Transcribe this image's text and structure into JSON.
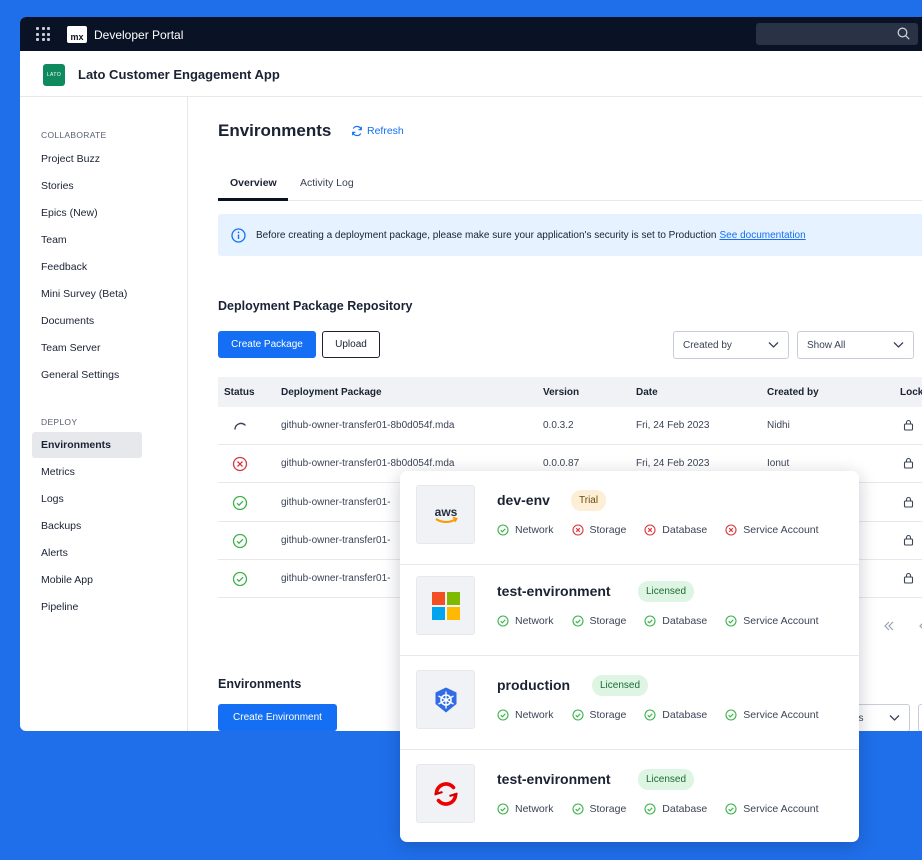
{
  "topbar": {
    "title": "Developer Portal",
    "logo_text": "mx"
  },
  "app": {
    "name": "Lato Customer Engagement App",
    "logo_text": "LATO"
  },
  "sidebar": {
    "collaborate_label": "COLLABORATE",
    "collaborate_items": [
      "Project Buzz",
      "Stories",
      "Epics (New)",
      "Team",
      "Feedback",
      "Mini Survey (Beta)",
      "Documents",
      "Team Server",
      "General Settings"
    ],
    "deploy_label": "DEPLOY",
    "deploy_items": [
      "Environments",
      "Metrics",
      "Logs",
      "Backups",
      "Alerts",
      "Mobile App",
      "Pipeline"
    ],
    "active_item": "Environments"
  },
  "main": {
    "title": "Environments",
    "refresh_label": "Refresh",
    "tabs": [
      "Overview",
      "Activity Log"
    ],
    "banner_text": "Before creating a deployment package, please make sure your application's security is set to Production",
    "banner_link": "See documentation",
    "repo_title": "Deployment Package Repository",
    "create_package_label": "Create Package",
    "upload_label": "Upload",
    "created_by_select": "Created by",
    "show_all_select": "Show All",
    "environments_title": "Environments",
    "create_environment_label": "Create Environment",
    "partial_select_text": "ces"
  },
  "table": {
    "headers": [
      "Status",
      "Deployment Package",
      "Version",
      "Date",
      "Created by",
      "Lock"
    ],
    "rows": [
      {
        "status": "loading",
        "package": "github-owner-transfer01-8b0d054f.mda",
        "version": "0.0.3.2",
        "date": "Fri, 24 Feb 2023",
        "created_by": "Nidhi"
      },
      {
        "status": "error",
        "package": "github-owner-transfer01-8b0d054f.mda",
        "version": "0.0.0.87",
        "date": "Fri, 24 Feb 2023",
        "created_by": "Ionut"
      },
      {
        "status": "success",
        "package": "github-owner-transfer01-",
        "version": "",
        "date": "",
        "created_by": ""
      },
      {
        "status": "success",
        "package": "github-owner-transfer01-",
        "version": "",
        "date": "",
        "created_by": ""
      },
      {
        "status": "success",
        "package": "github-owner-transfer01-",
        "version": "",
        "date": "",
        "created_by": ""
      }
    ]
  },
  "environments": [
    {
      "name": "dev-env",
      "badge": "Trial",
      "provider": "aws",
      "checks": [
        {
          "label": "Network",
          "ok": true
        },
        {
          "label": "Storage",
          "ok": false
        },
        {
          "label": "Database",
          "ok": false
        },
        {
          "label": "Service Account",
          "ok": false
        }
      ]
    },
    {
      "name": "test-environment",
      "badge": "Licensed",
      "provider": "microsoft",
      "checks": [
        {
          "label": "Network",
          "ok": true
        },
        {
          "label": "Storage",
          "ok": true
        },
        {
          "label": "Database",
          "ok": true
        },
        {
          "label": "Service Account",
          "ok": true
        }
      ]
    },
    {
      "name": "production",
      "badge": "Licensed",
      "provider": "kubernetes",
      "checks": [
        {
          "label": "Network",
          "ok": true
        },
        {
          "label": "Storage",
          "ok": true
        },
        {
          "label": "Database",
          "ok": true
        },
        {
          "label": "Service Account",
          "ok": true
        }
      ]
    },
    {
      "name": "test-environment",
      "badge": "Licensed",
      "provider": "openshift",
      "checks": [
        {
          "label": "Network",
          "ok": true
        },
        {
          "label": "Storage",
          "ok": true
        },
        {
          "label": "Database",
          "ok": true
        },
        {
          "label": "Service Account",
          "ok": true
        }
      ]
    }
  ],
  "colors": {
    "accent": "#146FF4",
    "success": "#3BB34A",
    "error": "#D9363E",
    "topbar": "#0A1325",
    "background": "#1F6FEB"
  }
}
